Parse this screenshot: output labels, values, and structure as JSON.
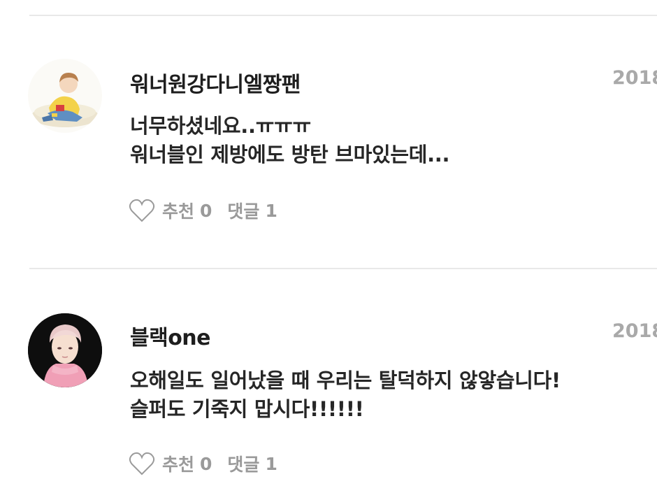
{
  "comments": [
    {
      "username": "워너원강다니엘짱팬",
      "date": "2018",
      "lines": [
        "너무하셨네요..ㅠㅠㅠ",
        "워너블인 제방에도 방탄 브마있는데..."
      ],
      "like_label": "추천",
      "like_count": "0",
      "reply_label": "댓글",
      "reply_count": "1",
      "avatar_icon": "avatar-illustration-yellow-sweater"
    },
    {
      "username": "블랙one",
      "date": "2018",
      "lines": [
        "오해일도 일어났을 때 우리는 탈덕하지 않앟습니다!",
        "슬퍼도 기죽지 맙시다!!!!!!"
      ],
      "like_label": "추천",
      "like_count": "0",
      "reply_label": "댓글",
      "reply_count": "1",
      "avatar_icon": "avatar-photo-pink-turtleneck"
    }
  ],
  "colors": {
    "divider": "#e8e8e8",
    "username": "#1e1e1e",
    "meta": "#a9a9a9",
    "action": "#9a9a9a"
  }
}
